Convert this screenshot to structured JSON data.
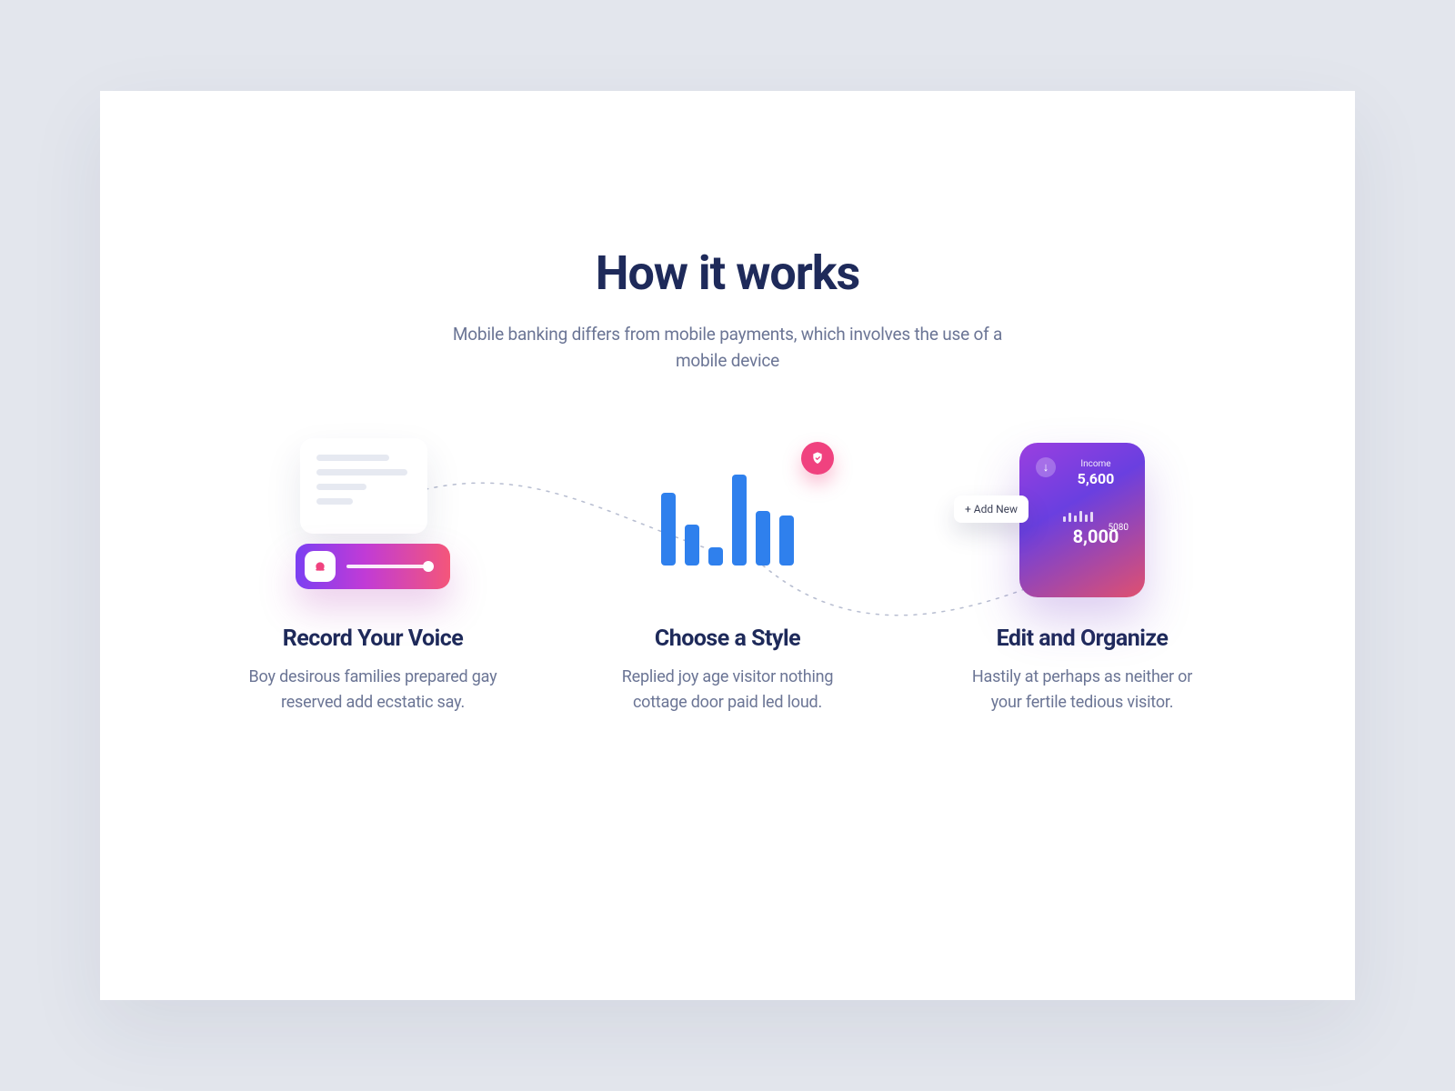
{
  "hero": {
    "title": "How it works",
    "subtitle": "Mobile banking differs from mobile payments, which involves the use of a mobile device"
  },
  "steps": [
    {
      "title": "Record Your Voice",
      "desc": "Boy desirous families prepared gay reserved add ecstatic say."
    },
    {
      "title": "Choose a Style",
      "desc": "Replied joy age visitor nothing cottage door paid led loud."
    },
    {
      "title": "Edit and Organize",
      "desc": "Hastily at perhaps as neither or your fertile tedious visitor."
    }
  ],
  "card": {
    "income_label": "Income",
    "income_value": "5,600",
    "secondary_small": "5080",
    "secondary_value": "8,000",
    "add_new": "+ Add New"
  },
  "icons": {
    "record": "🎙",
    "shield": "✦"
  }
}
